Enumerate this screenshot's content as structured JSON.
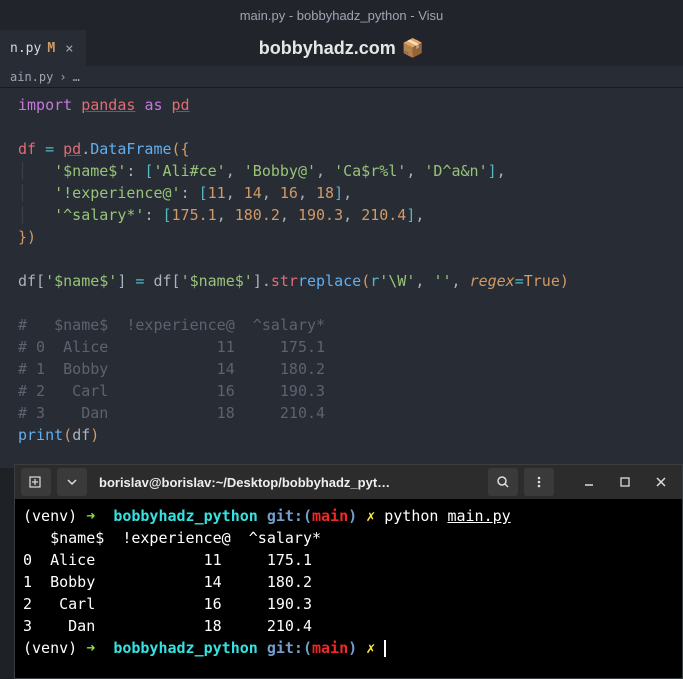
{
  "window": {
    "title": "main.py - bobbyhadz_python - Visu"
  },
  "tab": {
    "filename": "n.py",
    "mod": "M",
    "close": "×"
  },
  "watermark": {
    "text": "bobbyhadz.com",
    "icon": "📦"
  },
  "breadcrumb": {
    "file": "ain.py",
    "sep": "›",
    "more": "…"
  },
  "code": {
    "l1": {
      "import": "import",
      "pandas": "pandas",
      "as": "as",
      "pd": "pd"
    },
    "l3": {
      "df": "df",
      "eq": "=",
      "pd": "pd",
      "dot": ".",
      "DataFrame": "DataFrame",
      "open": "({"
    },
    "l4": {
      "k": "'$name$'",
      "colon": ": ",
      "ob": "[",
      "v1": "'Ali#ce'",
      "c": ",",
      "v2": "'Bobby@'",
      "v3": "'Ca$r%l'",
      "v4": "'D^a&n'",
      "cb": "]"
    },
    "l5": {
      "k": "'!experience@'",
      "colon": ": ",
      "ob": "[",
      "v1": "11",
      "c": ",",
      "v2": "14",
      "v3": "16",
      "v4": "18",
      "cb": "]"
    },
    "l6": {
      "k": "'^salary*'",
      "colon": ": ",
      "ob": "[",
      "v1": "175.1",
      "c": ",",
      "v2": "180.2",
      "v3": "190.3",
      "v4": "210.4",
      "cb": "]"
    },
    "l7": {
      "close": "})"
    },
    "l9": {
      "pre": "df[",
      "k": "'$name$'",
      "post": "] ",
      "eq": "=",
      "df2": " df[",
      "k2": "'$name$'",
      "post2": "].",
      "str": "str",
      ".": ".",
      "replace": "replace",
      "open": "(",
      "r": "r",
      "pat": "'\\W'",
      "c1": ", ",
      "empty": "''",
      "c2": ", ",
      "regex": "regex",
      "eq2": "=",
      "true": "True",
      "close": ")"
    },
    "c1": "#   $name$  !experience@  ^salary*",
    "c2": "# 0  Alice            11     175.1",
    "c3": "# 1  Bobby            14     180.2",
    "c4": "# 2   Carl            16     190.3",
    "c5": "# 3    Dan            18     210.4",
    "l16": {
      "print": "print",
      "open": "(",
      "df": "df",
      "close": ")"
    }
  },
  "terminal": {
    "title": "borislav@borislav:~/Desktop/bobbyhadz_pyt…",
    "prompt": {
      "venv": "(venv)",
      "arrow": "➜",
      "dir": "bobbyhadz_python",
      "git": "git:(",
      "branch": "main",
      "gitend": ")",
      "dirty": "✗"
    },
    "cmd": {
      "python": "python",
      "file": "main.py"
    },
    "out1": "   $name$  !experience@  ^salary*",
    "out2": "0  Alice            11     175.1",
    "out3": "1  Bobby            14     180.2",
    "out4": "2   Carl            16     190.3",
    "out5": "3    Dan            18     210.4"
  }
}
